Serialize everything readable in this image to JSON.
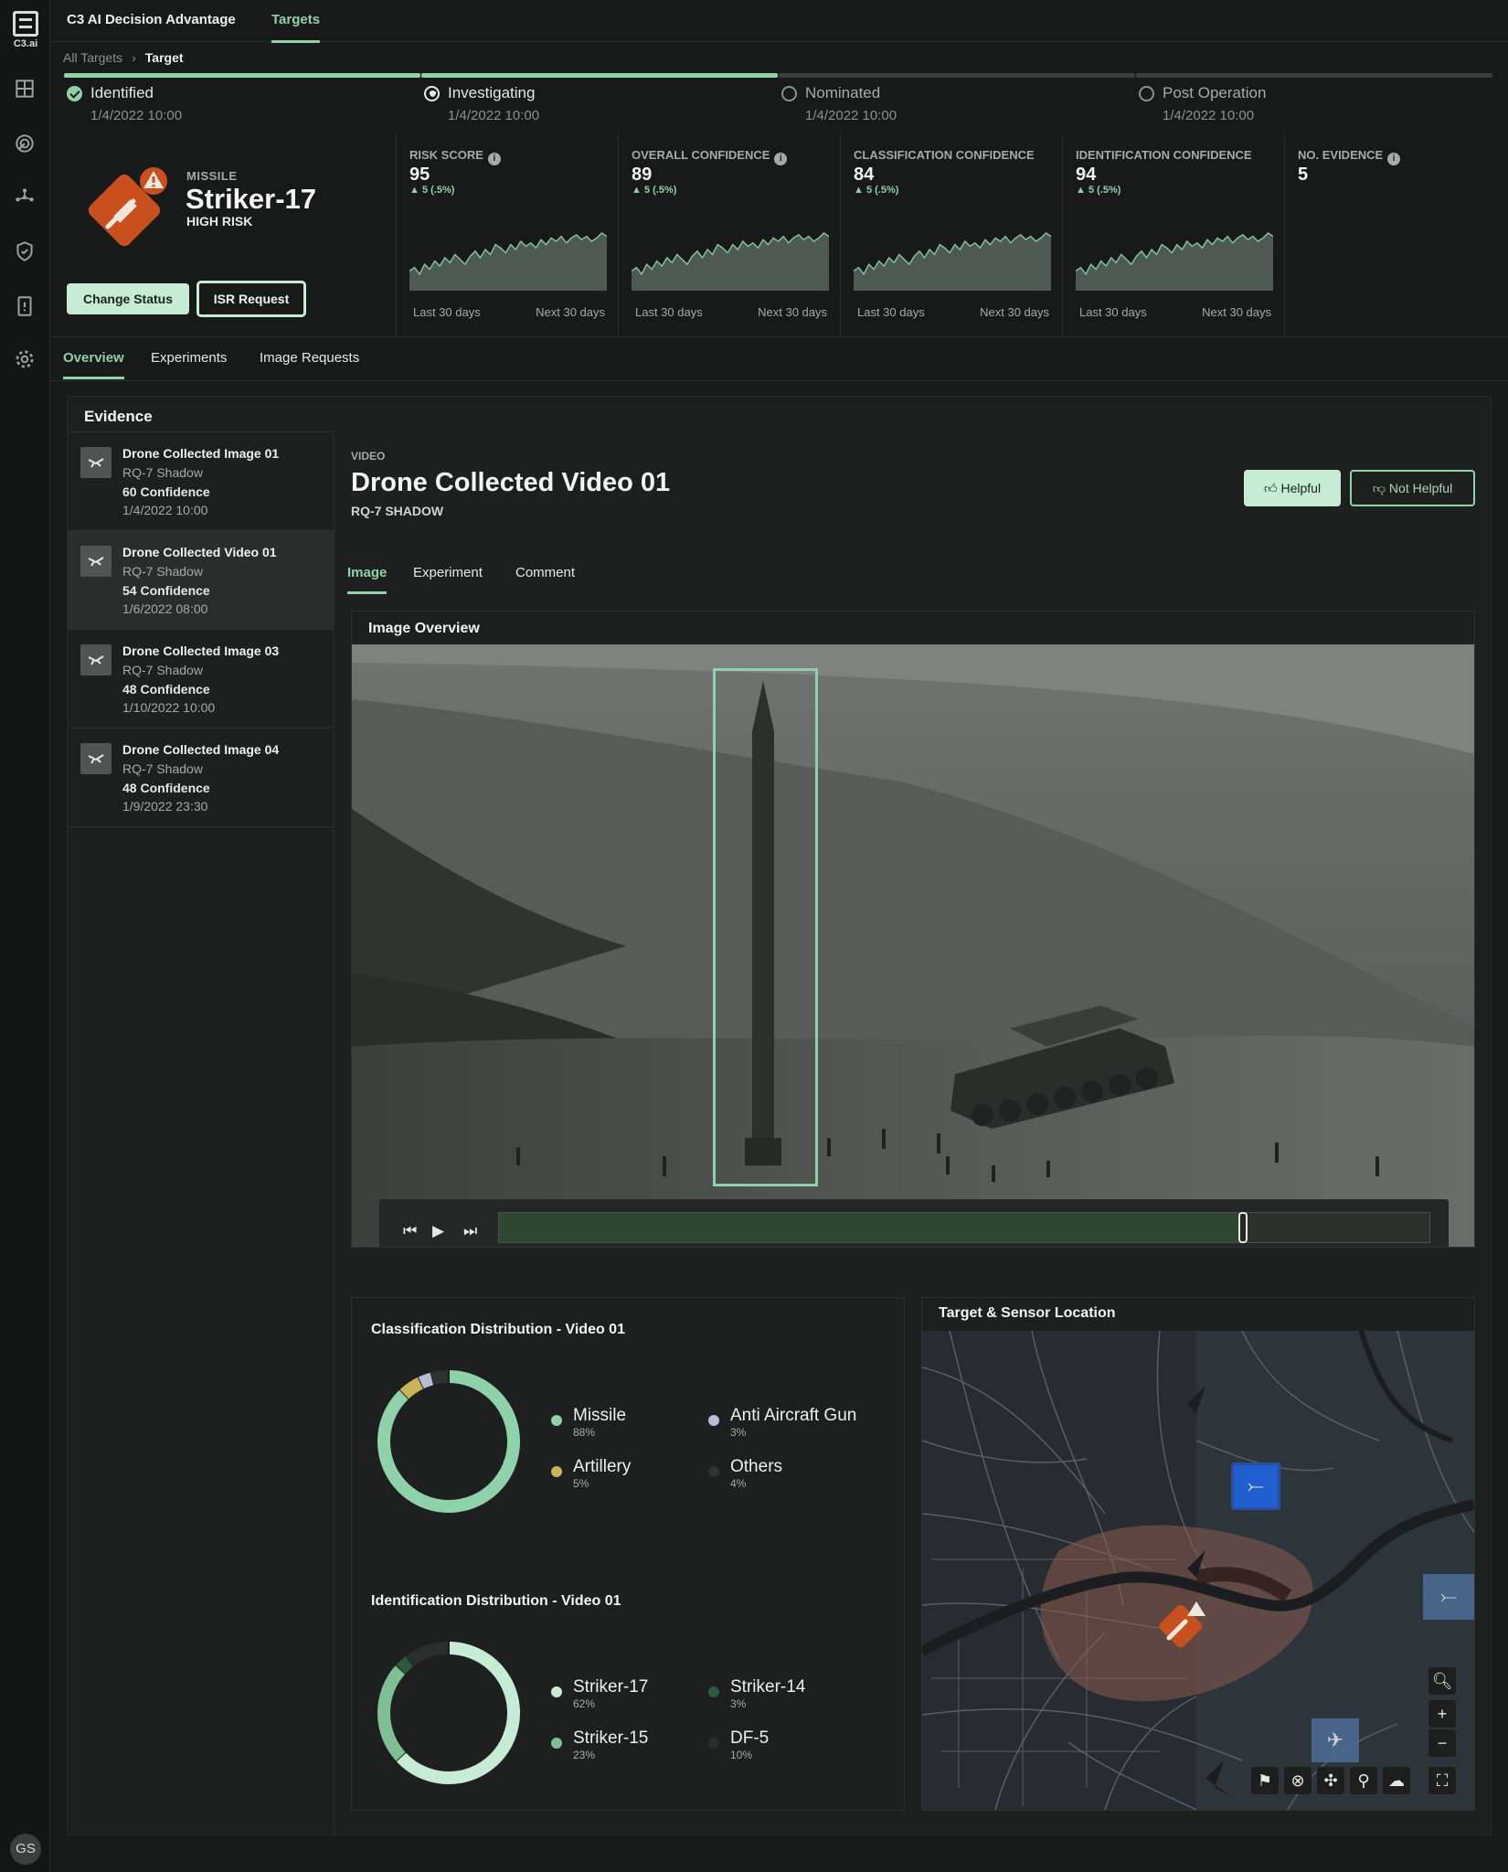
{
  "app": {
    "logo_text": "C3.ai",
    "title": "C3 AI Decision Advantage",
    "nav_tab": "Targets",
    "user_initials": "GS"
  },
  "breadcrumb": {
    "parent": "All Targets",
    "separator": "›",
    "current": "Target"
  },
  "steps": [
    {
      "label": "Identified",
      "date": "1/4/2022 10:00",
      "state": "done"
    },
    {
      "label": "Investigating",
      "date": "1/4/2022 10:00",
      "state": "active"
    },
    {
      "label": "Nominated",
      "date": "1/4/2022 10:00",
      "state": "pending"
    },
    {
      "label": "Post Operation",
      "date": "1/4/2022 10:00",
      "state": "pending"
    }
  ],
  "target": {
    "type": "MISSILE",
    "name": "Striker-17",
    "risk": "HIGH RISK",
    "icon": "missile-warning-icon",
    "change_status_label": "Change Status",
    "isr_request_label": "ISR Request"
  },
  "metrics": [
    {
      "label": "RISK SCORE",
      "info": true,
      "value": "95",
      "delta": "▲ 5 (.5%)",
      "axis_left": "Last 30 days",
      "axis_right": "Next 30 days"
    },
    {
      "label": "OVERALL CONFIDENCE",
      "info": true,
      "value": "89",
      "delta": "▲ 5 (.5%)",
      "axis_left": "Last 30 days",
      "axis_right": "Next 30 days"
    },
    {
      "label": "CLASSIFICATION CONFIDENCE",
      "info": false,
      "value": "84",
      "delta": "▲ 5 (.5%)",
      "axis_left": "Last 30 days",
      "axis_right": "Next 30 days"
    },
    {
      "label": "IDENTIFICATION CONFIDENCE",
      "info": false,
      "value": "94",
      "delta": "▲ 5 (.5%)",
      "axis_left": "Last 30 days",
      "axis_right": "Next 30 days"
    },
    {
      "label": "NO. EVIDENCE",
      "info": true,
      "value": "5"
    }
  ],
  "sparkline": [
    42,
    44,
    40,
    46,
    43,
    48,
    45,
    50,
    47,
    52,
    49,
    46,
    51,
    54,
    50,
    55,
    52,
    58,
    56,
    53,
    58,
    55,
    60,
    57,
    59,
    56,
    61,
    58,
    62,
    60,
    63,
    59,
    62,
    64,
    61,
    63,
    60,
    62,
    65,
    63
  ],
  "subtabs": [
    "Overview",
    "Experiments",
    "Image Requests"
  ],
  "evidence": {
    "title": "Evidence",
    "items": [
      {
        "title": "Drone Collected Image 01",
        "source": "RQ-7 Shadow",
        "confidence": "60 Confidence",
        "date": "1/4/2022 10:00"
      },
      {
        "title": "Drone Collected Video 01",
        "source": "RQ-7 Shadow",
        "confidence": "54 Confidence",
        "date": "1/6/2022 08:00"
      },
      {
        "title": "Drone Collected Image 03",
        "source": "RQ-7 Shadow",
        "confidence": "48 Confidence",
        "date": "1/10/2022 10:00"
      },
      {
        "title": "Drone Collected Image 04",
        "source": "RQ-7 Shadow",
        "confidence": "48 Confidence",
        "date": "1/9/2022 23:30"
      }
    ]
  },
  "detail": {
    "kind": "VIDEO",
    "title": "Drone Collected Video 01",
    "subtitle": "RQ-7 SHADOW",
    "helpful_label": "Helpful",
    "not_helpful_label": "Not Helpful",
    "tabs": [
      "Image",
      "Experiment",
      "Comment"
    ],
    "image_overview_title": "Image Overview",
    "playback_progress": 0.8
  },
  "classification": {
    "title": "Classification Distribution - Video 01",
    "items": [
      {
        "name": "Missile",
        "pct": "88%",
        "value": 88,
        "color": "#8fd1a9"
      },
      {
        "name": "Anti Aircraft Gun",
        "pct": "3%",
        "value": 3,
        "color": "#b8bdd6"
      },
      {
        "name": "Artillery",
        "pct": "5%",
        "value": 5,
        "color": "#c9b45a"
      },
      {
        "name": "Others",
        "pct": "4%",
        "value": 4,
        "color": "#2e3230"
      }
    ]
  },
  "identification": {
    "title": "Identification Distribution - Video 01",
    "items": [
      {
        "name": "Striker-17",
        "pct": "62%",
        "value": 62,
        "color": "#c6ecd3"
      },
      {
        "name": "Striker-14",
        "pct": "3%",
        "value": 3,
        "color": "#2e5a3c"
      },
      {
        "name": "Striker-15",
        "pct": "23%",
        "value": 23,
        "color": "#7fbf93"
      },
      {
        "name": "DF-5",
        "pct": "10%",
        "value": 10,
        "color": "#2a2e2c"
      }
    ]
  },
  "map": {
    "title": "Target & Sensor Location"
  }
}
